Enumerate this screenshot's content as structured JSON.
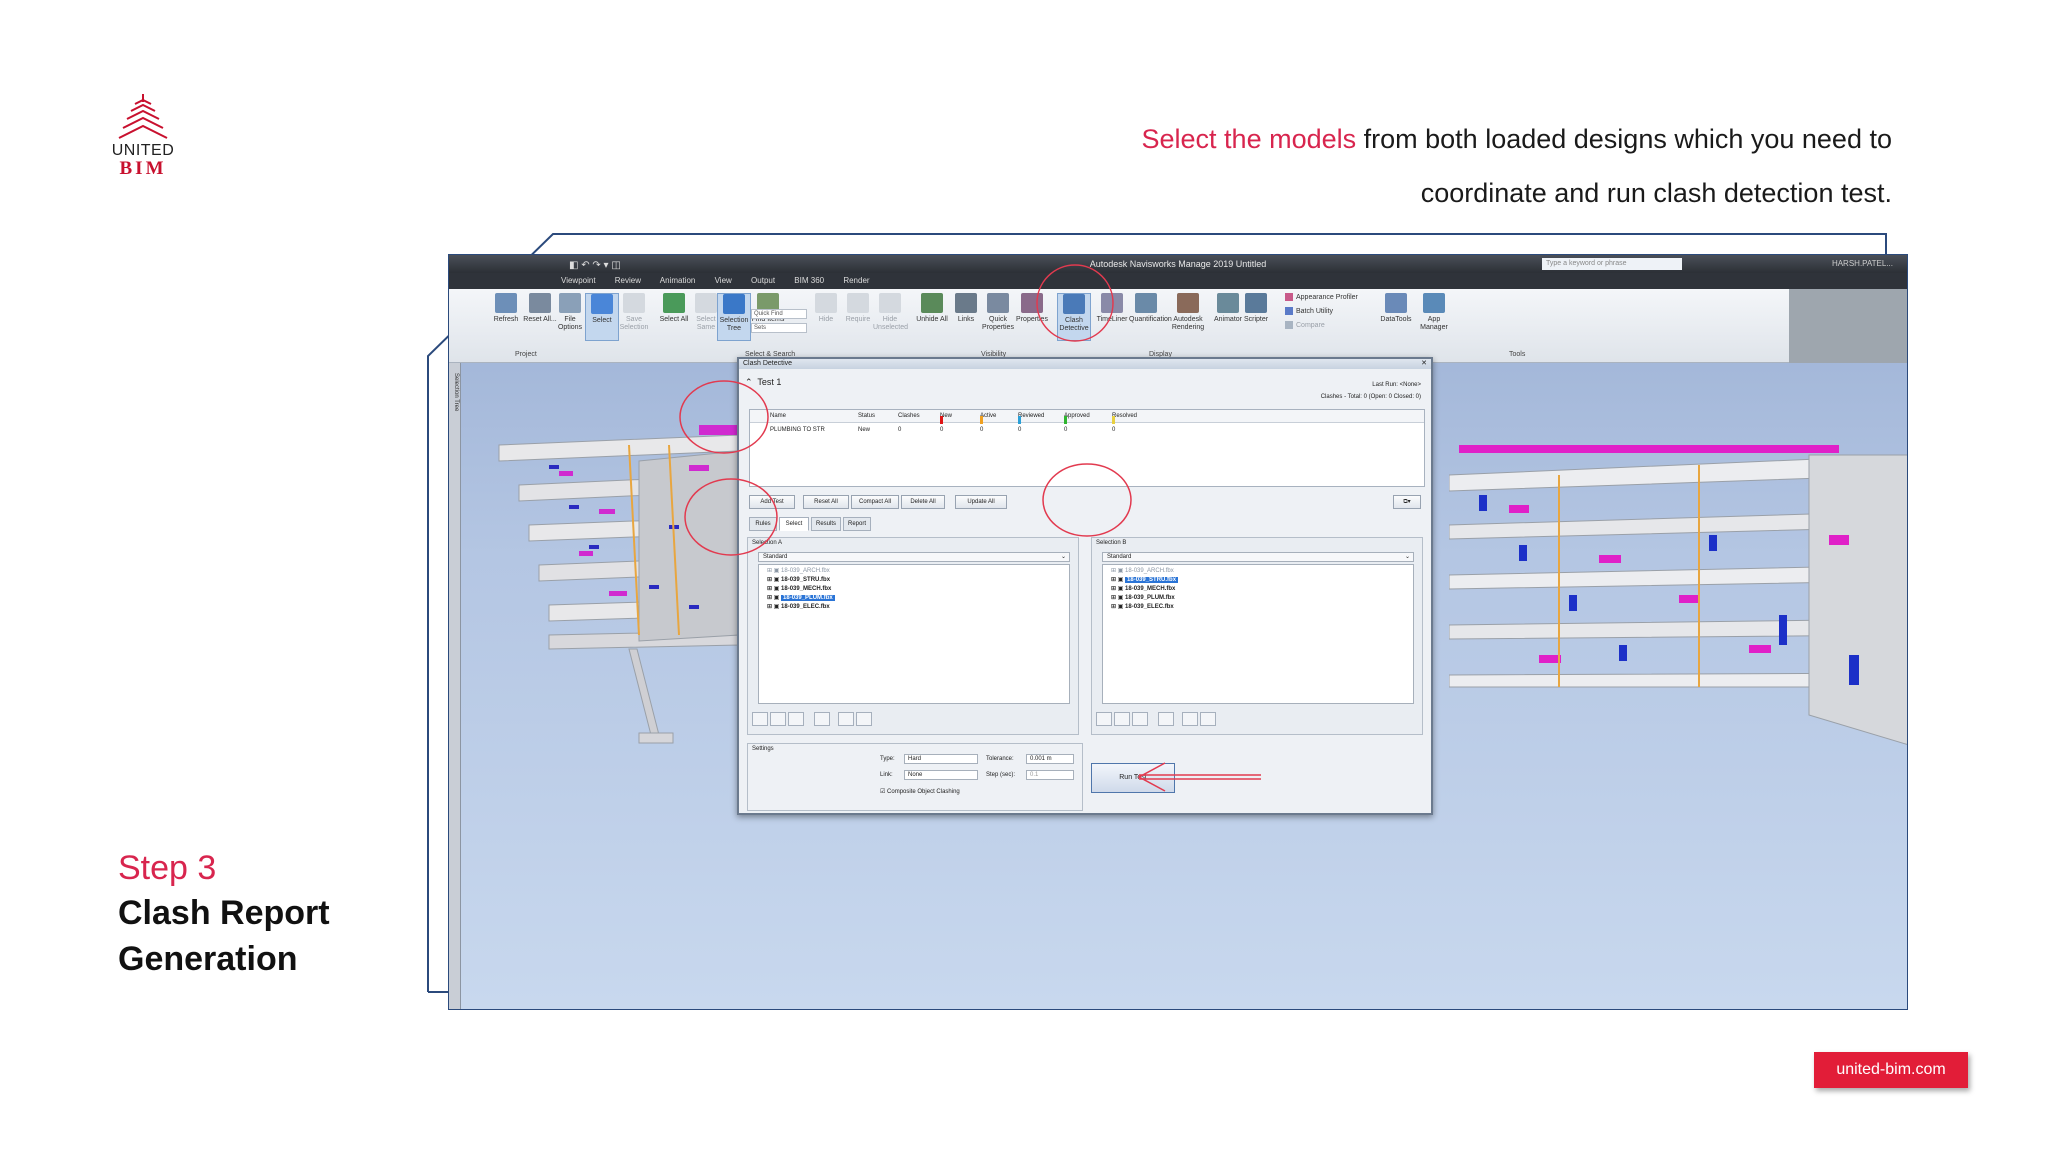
{
  "brand": {
    "logo_top": "UNITED",
    "logo_bottom": "BIM",
    "site": "united-bim.com"
  },
  "instruction": {
    "highlight": "Select the models",
    "rest_line1": " from both loaded designs which you need to",
    "line2": "coordinate and run clash detection test."
  },
  "step": {
    "number": "Step 3",
    "title_line1": "Clash Report",
    "title_line2": "Generation"
  },
  "colors": {
    "accent": "#d8254e",
    "badge": "#e21d38",
    "frame": "#2b4a7c",
    "annotation": "#e23a4f"
  },
  "app": {
    "title": "Autodesk Navisworks Manage 2019   Untitled",
    "search_placeholder": "Type a keyword or phrase",
    "user": "HARSH.PATEL...",
    "ribbon_tabs": [
      "Viewpoint",
      "Review",
      "Animation",
      "View",
      "Output",
      "BIM 360",
      "Render"
    ],
    "ribbon_buttons": [
      {
        "label": "Refresh",
        "icon": "refresh-icon"
      },
      {
        "label": "Reset All...",
        "icon": "reset-icon"
      },
      {
        "label": "File Options",
        "icon": "file-options-icon"
      },
      {
        "label": "Select",
        "icon": "cursor-icon",
        "active": true
      },
      {
        "label": "Save Selection",
        "icon": "save-selection-icon",
        "dim": true
      },
      {
        "label": "Select All",
        "icon": "select-all-icon"
      },
      {
        "label": "Select Same",
        "icon": "select-same-icon",
        "dim": true
      },
      {
        "label": "Selection Tree",
        "icon": "selection-tree-icon",
        "active": true
      },
      {
        "label": "Find Items",
        "icon": "find-items-icon"
      },
      {
        "label": "Hide",
        "icon": "hide-icon",
        "dim": true
      },
      {
        "label": "Require",
        "icon": "require-icon",
        "dim": true
      },
      {
        "label": "Hide Unselected",
        "icon": "hide-unselected-icon",
        "dim": true
      },
      {
        "label": "Unhide All",
        "icon": "unhide-icon"
      },
      {
        "label": "Links",
        "icon": "links-icon"
      },
      {
        "label": "Quick Properties",
        "icon": "quick-properties-icon"
      },
      {
        "label": "Properties",
        "icon": "properties-icon"
      },
      {
        "label": "Clash Detective",
        "icon": "clash-detective-icon",
        "active": true
      },
      {
        "label": "TimeLiner",
        "icon": "timeliner-icon"
      },
      {
        "label": "Quantification",
        "icon": "quantification-icon"
      },
      {
        "label": "Autodesk Rendering",
        "icon": "rendering-icon"
      },
      {
        "label": "Animator",
        "icon": "animator-icon"
      },
      {
        "label": "Scripter",
        "icon": "scripter-icon"
      },
      {
        "label": "Appearance Profiler",
        "icon": "appearance-profiler-icon"
      },
      {
        "label": "Batch Utility",
        "icon": "batch-utility-icon"
      },
      {
        "label": "Compare",
        "icon": "compare-icon",
        "dim": true
      },
      {
        "label": "DataTools",
        "icon": "datatools-icon"
      },
      {
        "label": "App Manager",
        "icon": "app-manager-icon"
      }
    ],
    "ribbon_groups": [
      "Project",
      "Select & Search",
      "Visibility",
      "Display",
      "Tools"
    ],
    "quick_find": "Quick Find",
    "sets_label": "Sets",
    "side_strip_label": "Selection Tree"
  },
  "clash": {
    "title": "Clash Detective",
    "test_name": "Test 1",
    "last_run": "Last Run:  <None>",
    "totals": "Clashes - Total: 0  (Open: 0  Closed: 0)",
    "columns": [
      "Name",
      "Status",
      "Clashes",
      "New",
      "Active",
      "Reviewed",
      "Approved",
      "Resolved"
    ],
    "column_colors": [
      "",
      "",
      "",
      "#e01515",
      "#f0a020",
      "#2aa0d8",
      "#2fb52f",
      "#e8d040"
    ],
    "row": [
      "PLUMBING TO STR",
      "New",
      "0",
      "0",
      "0",
      "0",
      "0",
      "0"
    ],
    "buttons": [
      "Add Test",
      "Reset All",
      "Compact All",
      "Delete All",
      "Update All"
    ],
    "tabs": [
      "Rules",
      "Select",
      "Results",
      "Report"
    ],
    "active_tab": "Select",
    "selection_a": {
      "label": "Selection A",
      "mode": "Standard",
      "items": [
        "18-039_ARCH.fbx",
        "18-039_STRU.fbx",
        "18-039_MECH.fbx",
        "18-039_PLUM.fbx",
        "18-039_ELEC.fbx"
      ],
      "selected": "18-039_PLUM.fbx"
    },
    "selection_b": {
      "label": "Selection B",
      "mode": "Standard",
      "items": [
        "18-039_ARCH.fbx",
        "18-039_STRU.fbx",
        "18-039_MECH.fbx",
        "18-039_PLUM.fbx",
        "18-039_ELEC.fbx"
      ],
      "selected": "18-039_STRU.fbx"
    },
    "settings": {
      "label": "Settings",
      "type_label": "Type:",
      "type_value": "Hard",
      "tolerance_label": "Tolerance:",
      "tolerance_value": "0.001 m",
      "link_label": "Link:",
      "link_value": "None",
      "step_label": "Step (sec):",
      "step_value": "0.1",
      "composite": "Composite Object Clashing"
    },
    "run_button": "Run Test"
  }
}
